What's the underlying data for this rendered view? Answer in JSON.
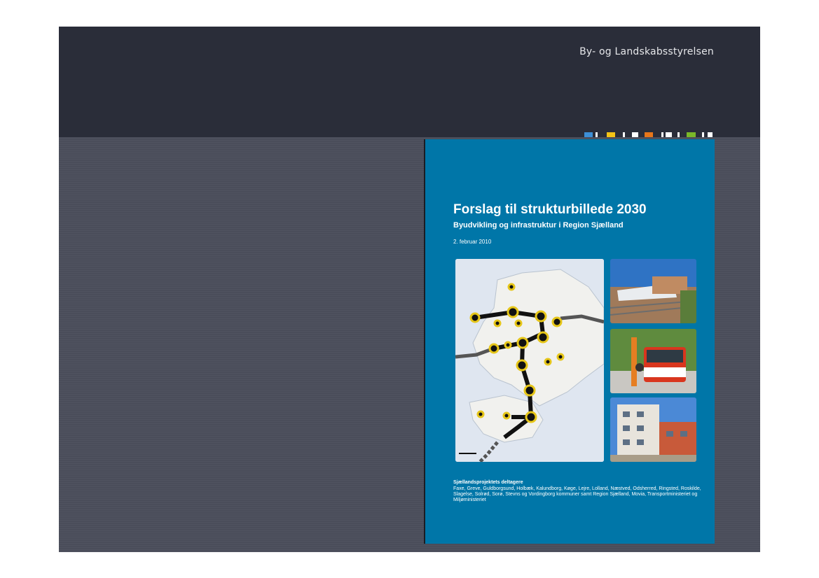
{
  "slide": {
    "brand": "By- og Landskabsstyrelsen",
    "accent_colors": [
      "#3d8fd6",
      "#f3c316",
      "#e8761a",
      "#7ab829",
      "#ffffff"
    ]
  },
  "cover": {
    "title": "Forslag til strukturbillede 2030",
    "subtitle": "Byudvikling og infrastruktur i Region Sjælland",
    "date": "2. februar 2010",
    "participants_heading": "Sjællandsprojektets deltagere",
    "participants_text": "Faxe, Greve, Guldborgsund, Holbæk, Kalundborg, Køge, Lejre, Lolland, Næstved, Odsherred, Ring­sted, Roskilde, Slagelse, Solrød, Sorø, Stevns og Vordingborg kommuner samt Region Sjælland, Movia, Transportministeriet og Miljøministeriet",
    "background_color": "#0076a8",
    "images": [
      "map-of-zealand",
      "train-photo",
      "bus-photo",
      "buildings-photo"
    ]
  }
}
